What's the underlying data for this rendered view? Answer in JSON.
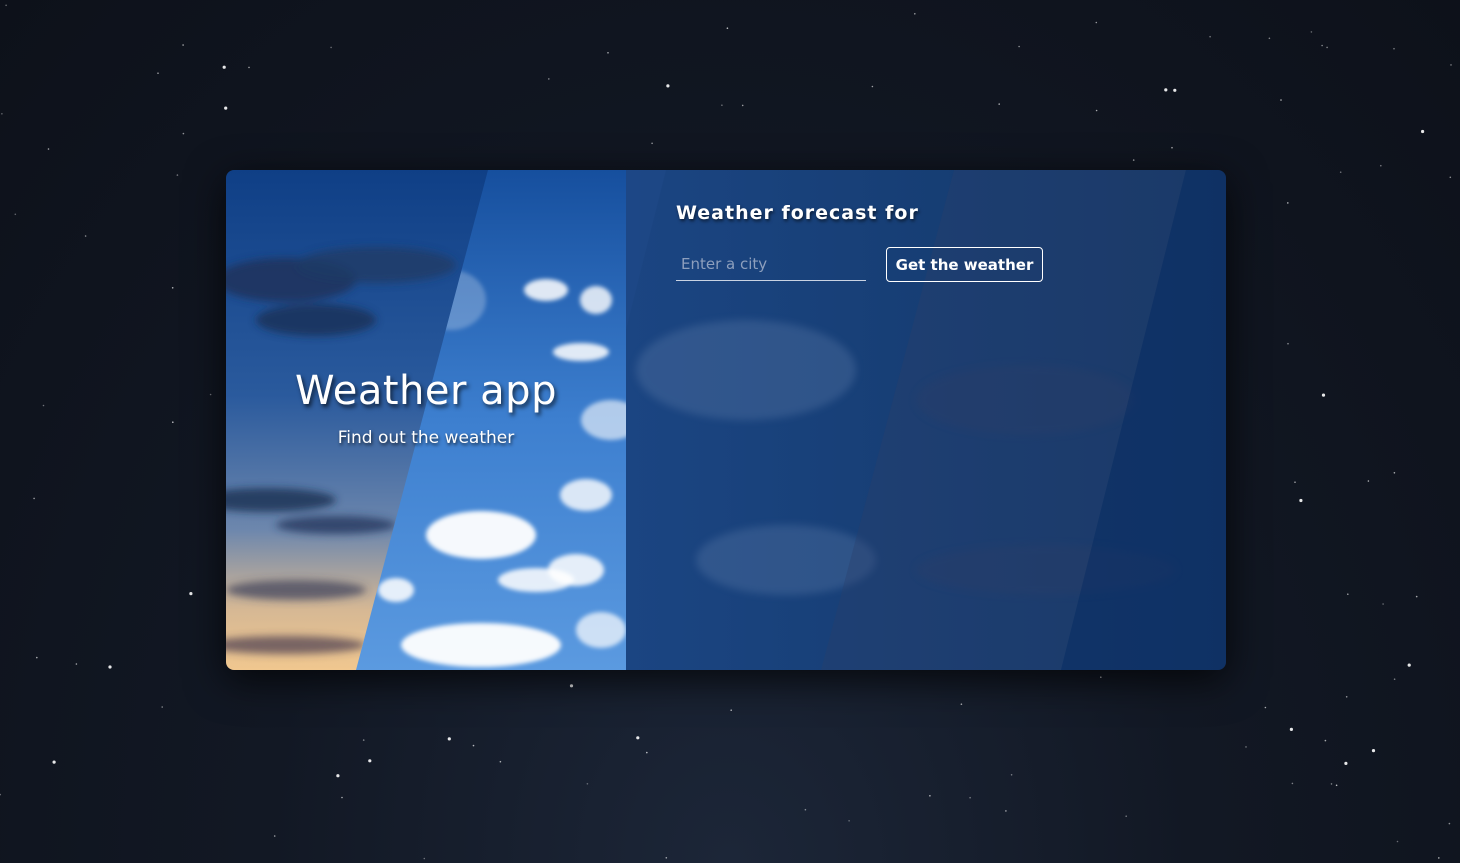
{
  "hero": {
    "title": "Weather app",
    "subtitle": "Find out the weather"
  },
  "form": {
    "title": "Weather forecast for",
    "city_input": {
      "value": "",
      "placeholder": "Enter a city"
    },
    "submit_label": "Get the weather"
  },
  "colors": {
    "night_background": "#121824",
    "card_blue": "#123869",
    "sky_blue": "#3f82d2",
    "button_border": "#ffffff"
  },
  "icons": {
    "moon": "crescent-moon-icon"
  }
}
